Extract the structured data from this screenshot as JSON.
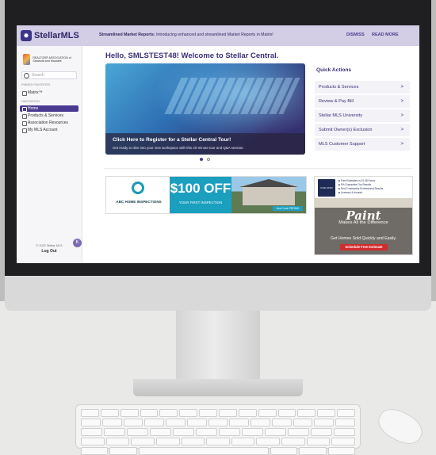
{
  "app": {
    "name": "StellarMLS",
    "logo_glyph": "✸"
  },
  "banner": {
    "lead": "Streamlined Market Reports:",
    "text": "Introducing enhanced and streamlined Market Reports in Matrix!",
    "dismiss": "DISMISS",
    "read_more": "READ MORE"
  },
  "sidebar": {
    "association": "REALTOR® ASSOCIATION of Sarasota and Manatee",
    "search_placeholder": "Search",
    "pinned_header": "PINNED FAVORITES",
    "pinned": [
      {
        "label": "Matrix™"
      }
    ],
    "nav_header": "NAVIGATION",
    "nav": [
      {
        "label": "Home",
        "icon": "home-icon",
        "active": true
      },
      {
        "label": "Products & Services",
        "icon": "grid-icon",
        "active": false
      },
      {
        "label": "Association Resources",
        "icon": "building-icon",
        "active": false
      },
      {
        "label": "My MLS Account",
        "icon": "user-icon",
        "active": false
      }
    ],
    "copyright": "© 2022 Stellar MLS",
    "logout": "Log Out",
    "chat_glyph": "K"
  },
  "main": {
    "greeting": "Hello, SMLSTEST48! Welcome to Stellar Central.",
    "hero": {
      "title": "Click Here to Register for a Stellar Central Tour!",
      "subtitle": "Get ready to dive into your new workspace with this 20-minute tour and Q&A session."
    },
    "carousel": {
      "pages": 2,
      "current": 1
    }
  },
  "quick_actions": {
    "title": "Quick Actions",
    "items": [
      {
        "label": "Products & Services"
      },
      {
        "label": "Review & Pay Bill"
      },
      {
        "label": "Stellar MLS University"
      },
      {
        "label": "Submit Owner(s) Exclusion"
      },
      {
        "label": "MLS Customer Support"
      }
    ],
    "chevron": ">"
  },
  "ads": {
    "inspection": {
      "brand": "ABC HOME INSPECTIONS",
      "offer": "$100 OFF",
      "offer_sub": "YOUR FIRST INSPECTION",
      "code": "Use Code PROMO"
    },
    "paint": {
      "badge": "FIVE STAR",
      "features": [
        "Free Estimates in 24-48 Hours",
        "5% Guarantee Our Results",
        "Find Trustworthy Professional Results",
        "Licensed & Insured"
      ],
      "word": "Paint",
      "tagline": "Makes All the Difference",
      "sold": "Get Homes Sold Quickly and Easily.",
      "button": "Schedule Free Estimate"
    }
  },
  "colors": {
    "brand": "#4b3a91",
    "banner_bg": "#d3cde6",
    "ad_teal": "#1b9fbf",
    "paint_button": "#d22b2b"
  }
}
